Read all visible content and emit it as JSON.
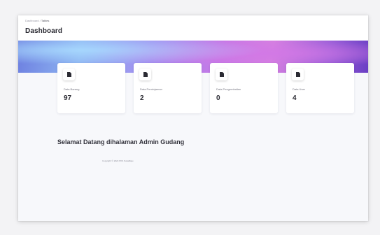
{
  "breadcrumb": {
    "root": "Dashboard",
    "separator": " / ",
    "current": "Tables"
  },
  "page": {
    "title": "Dashboard"
  },
  "cards": [
    {
      "icon": "file-icon",
      "label": "Data Barang",
      "value": "97"
    },
    {
      "icon": "file-icon",
      "label": "Data Peminjaman",
      "value": "2"
    },
    {
      "icon": "file-icon",
      "label": "Data Pengembalian",
      "value": "0"
    },
    {
      "icon": "file-icon",
      "label": "Data User",
      "value": "4"
    }
  ],
  "welcome": {
    "text": "Selamat Datang dihalaman Admin Gudang"
  },
  "footer": {
    "copyright": "Copyright © 2024 PKS SukaMaju"
  },
  "colors": {
    "title_text": "#2b2b33",
    "card_bg": "#ffffff",
    "content_bg": "#f7f8fb"
  }
}
